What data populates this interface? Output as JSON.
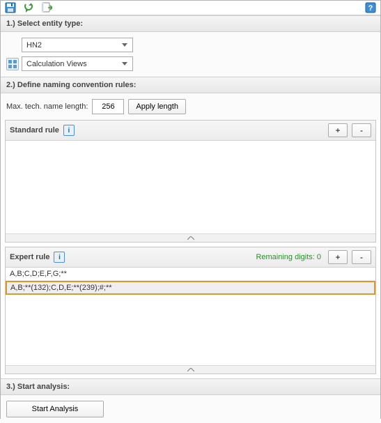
{
  "toolbar": {
    "save_title": "Save",
    "refresh_title": "Refresh",
    "export_title": "Export",
    "help_title": "Help"
  },
  "section1": {
    "title": "1.) Select entity type:",
    "system_select": "HN2",
    "type_select": "Calculation Views"
  },
  "section2": {
    "title": "2.) Define naming convention rules:",
    "max_length_label": "Max. tech. name length:",
    "max_length_value": "256",
    "apply_length_btn": "Apply length"
  },
  "standard_rule": {
    "title": "Standard rule",
    "add_btn": "+",
    "remove_btn": "-"
  },
  "expert_rule": {
    "title": "Expert rule",
    "remaining_label": "Remaining digits: 0",
    "add_btn": "+",
    "remove_btn": "-",
    "rows": [
      {
        "text": "A,B;C,D;E,F,G;**",
        "selected": false
      },
      {
        "text": "A,B;**(132);C,D,E;**(239);#;**",
        "selected": true
      }
    ]
  },
  "section3": {
    "title": "3.) Start analysis:",
    "start_btn": "Start Analysis"
  }
}
